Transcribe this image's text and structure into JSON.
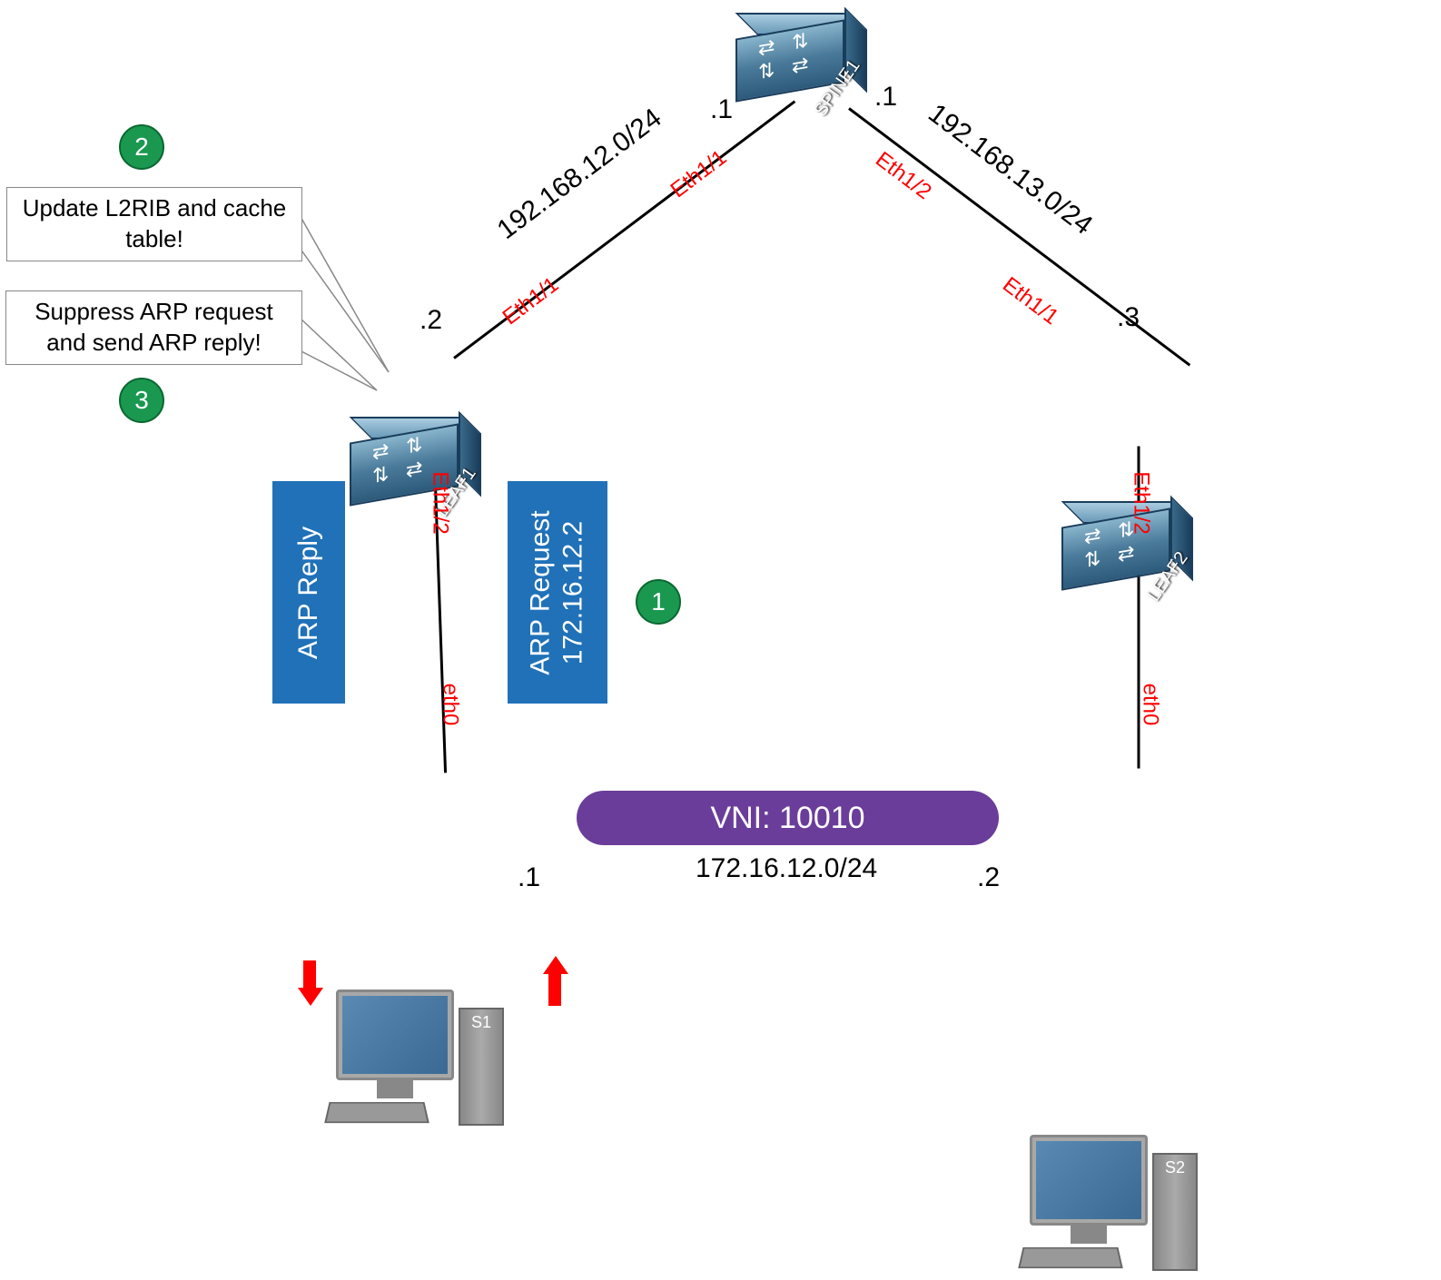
{
  "devices": {
    "spine1": {
      "label": "SPINE1"
    },
    "leaf1": {
      "label": "LEAF1"
    },
    "leaf2": {
      "label": "LEAF2"
    },
    "s1": {
      "label": "S1"
    },
    "s2": {
      "label": "S2"
    }
  },
  "links": {
    "spine_leaf1": {
      "subnet": "192.168.12.0/24",
      "spine_iface": "Eth1/1",
      "spine_ip": ".1",
      "leaf_iface": "Eth1/1",
      "leaf_ip": ".2"
    },
    "spine_leaf2": {
      "subnet": "192.168.13.0/24",
      "spine_iface": "Eth1/2",
      "spine_ip": ".1",
      "leaf_iface": "Eth1/1",
      "leaf_ip": ".3"
    },
    "leaf1_s1": {
      "leaf_iface": "Eth1/2",
      "host_iface": "eth0",
      "host_ip": ".1"
    },
    "leaf2_s2": {
      "leaf_iface": "Eth1/2",
      "host_iface": "eth0",
      "host_ip": ".2"
    }
  },
  "overlay": {
    "vni_label": "VNI: 10010",
    "subnet": "172.16.12.0/24"
  },
  "callouts": {
    "step2": "Update L2RIB and cache table!",
    "step3": "Suppress ARP request and send ARP reply!"
  },
  "steps": {
    "s1": "1",
    "s2": "2",
    "s3": "3"
  },
  "arp": {
    "request_title": "ARP Request",
    "request_target": "172.16.12.2",
    "reply_title": "ARP Reply"
  }
}
